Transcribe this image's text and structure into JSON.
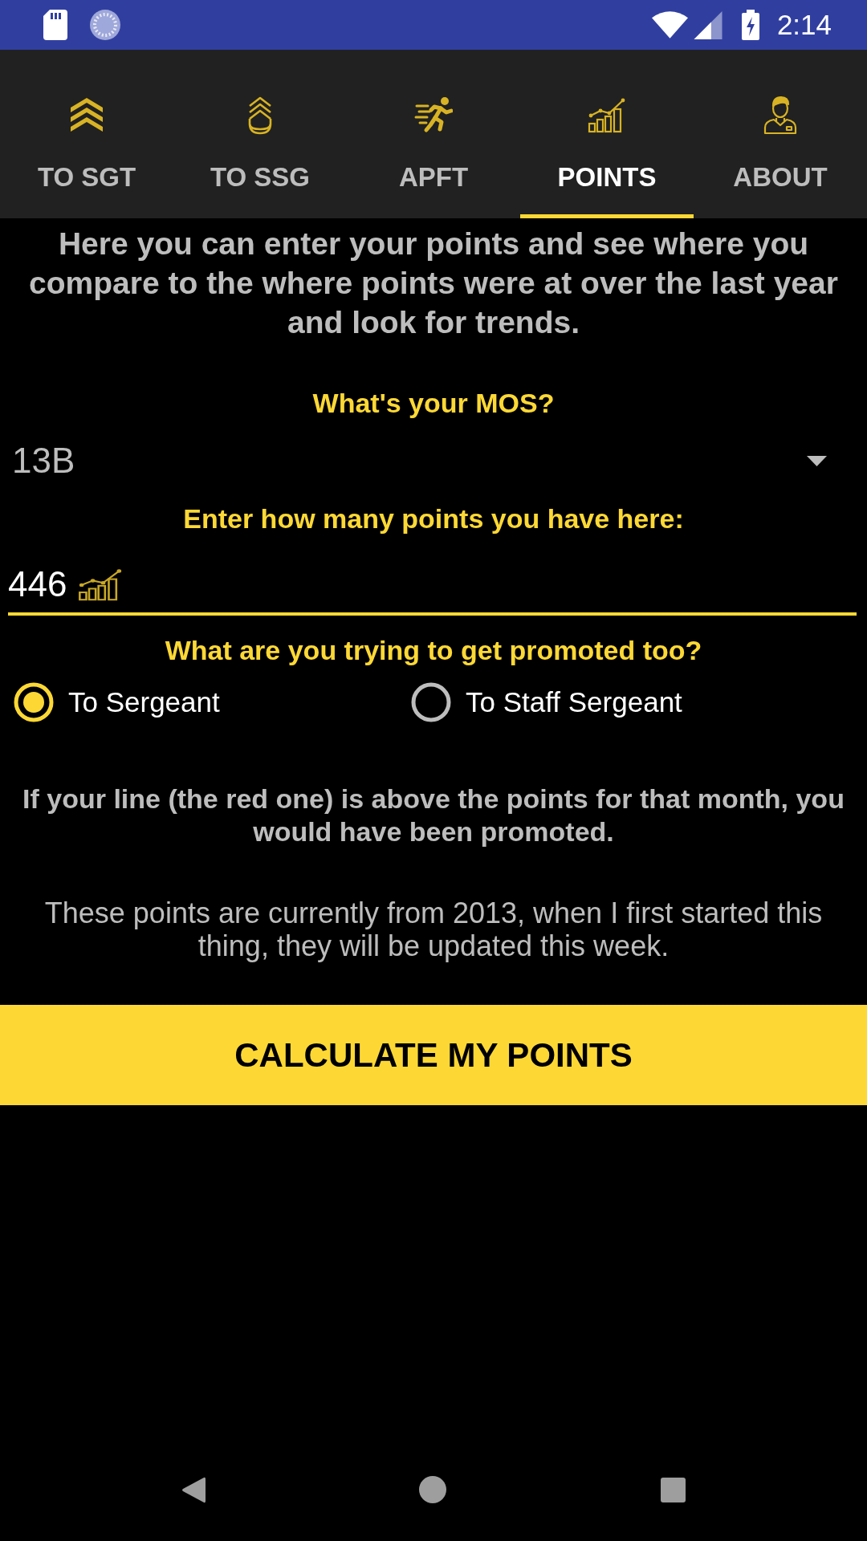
{
  "status_bar": {
    "time": "2:14"
  },
  "tabs": [
    {
      "label": "TO SGT",
      "kind": "chevrons",
      "selected": false
    },
    {
      "label": "TO SSG",
      "kind": "rocker",
      "selected": false
    },
    {
      "label": "APFT",
      "kind": "runner",
      "selected": false
    },
    {
      "label": "POINTS",
      "kind": "chart",
      "selected": true
    },
    {
      "label": "ABOUT",
      "kind": "person",
      "selected": false
    }
  ],
  "intro": "Here you can enter your points and see where you compare to the where points were at over the last year and look for trends.",
  "mos": {
    "label": "What's your MOS?",
    "value": "13B"
  },
  "points": {
    "label": "Enter how many points you have here:",
    "value": "446"
  },
  "promotion": {
    "label": "What are you trying to get promoted too?",
    "options": [
      {
        "label": "To Sergeant",
        "selected": true
      },
      {
        "label": "To Staff Sergeant",
        "selected": false
      }
    ]
  },
  "notes": [
    {
      "text": "If your line (the red one) is above the points for that month, you would have been promoted.",
      "kind": "bold"
    },
    {
      "text": "These points are currently from 2013, when I first started this thing, they will be updated this week.",
      "kind": "plain"
    }
  ],
  "button": {
    "label": "CALCULATE MY POINTS"
  }
}
